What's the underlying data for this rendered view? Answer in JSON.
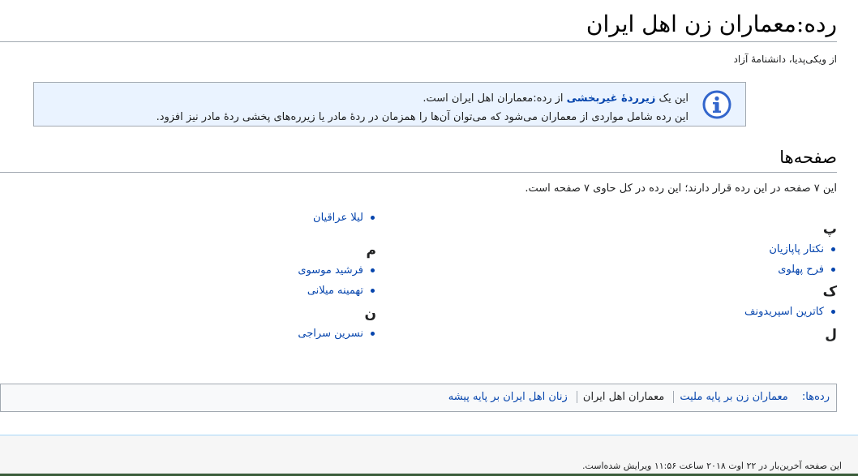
{
  "page": {
    "title": "رده:معماران زن اهل ایران",
    "tagline": "از ویکی‌پدیا، دانشنامهٔ آزاد"
  },
  "infobox": {
    "icon": "info-icon",
    "line1_before": "این یک ",
    "line1_bold": "زیرردهٔ غیربخشی",
    "line1_after": " از رده:معماران اهل ایران است.",
    "line2": "این رده شامل مواردی از معماران می‌شود که می‌توان آن‌ها را همزمان در ردهٔ مادر یا زیرره‌های پخشی ردهٔ مادر نیز افزود."
  },
  "section": {
    "heading": "صفحه‌ها",
    "count_text": "این ۷ صفحه در این رده قرار دارند؛ این رده در کل حاوی ۷ صفحه است."
  },
  "groups_right": [
    {
      "letter": "پ",
      "items": [
        "نکتار پاپازیان",
        "فرح پهلوی"
      ]
    },
    {
      "letter": "ک",
      "items": [
        "کاترین اسپریدونف"
      ]
    },
    {
      "letter": "ل",
      "items": []
    }
  ],
  "groups_left": [
    {
      "letter": "",
      "items": [
        "لیلا عراقیان"
      ]
    },
    {
      "letter": "م",
      "items": [
        "فرشید موسوی",
        "تهمینه میلانی"
      ]
    },
    {
      "letter": "ن",
      "items": [
        "نسرین سراجی"
      ]
    }
  ],
  "categories": {
    "label": "رده‌ها:",
    "items": [
      "معماران زن بر پایه ملیت",
      "معماران اهل ایران",
      "زنان اهل ایران بر پایه پیشه"
    ]
  },
  "footer": {
    "text": "این صفحه آخرین‌بار در ۲۲ اوت ۲۰۱۸ ساعت ۱۱:۵۶ ویرایش شده‌است."
  },
  "colors": {
    "link": "#0645ad",
    "infobox_bg": "#eaf3ff",
    "border": "#a2a9b1"
  }
}
